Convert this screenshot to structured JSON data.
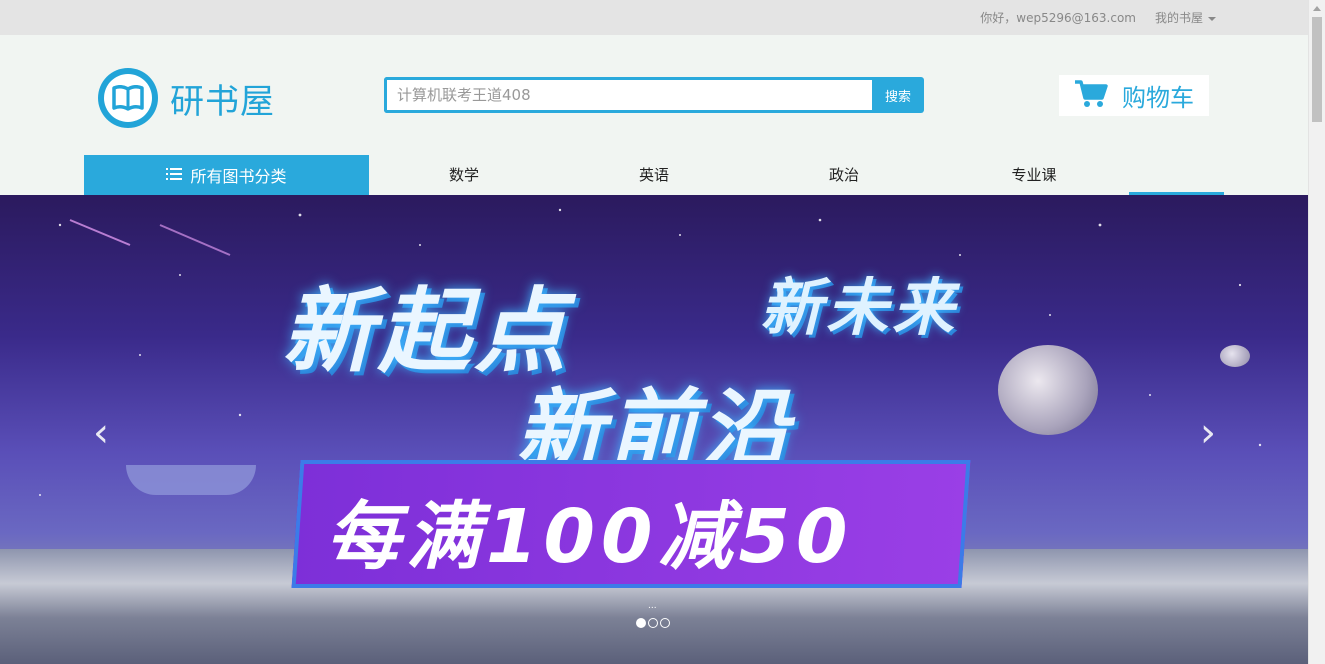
{
  "topbar": {
    "greeting": "你好，wep5296@163.com",
    "my_shelf": "我的书屋"
  },
  "header": {
    "logo_text": "研书屋",
    "search_placeholder": "计算机联考王道408",
    "search_button": "搜索",
    "cart_label": "购物车"
  },
  "nav": {
    "all_categories": "所有图书分类",
    "items": [
      "数学",
      "英语",
      "政治",
      "专业课"
    ]
  },
  "banner": {
    "line1": "新起点",
    "line2": "新未来",
    "line3": "新前沿",
    "promo": "每满100减50",
    "prev_icon": "chevron-left-icon",
    "next_icon": "chevron-right-icon",
    "slide_count": 3,
    "active_slide": 1,
    "hint": "..."
  },
  "colors": {
    "accent": "#2aa9dc",
    "topbar_bg": "#e4e4e4",
    "page_bg": "#f1f5f2"
  }
}
